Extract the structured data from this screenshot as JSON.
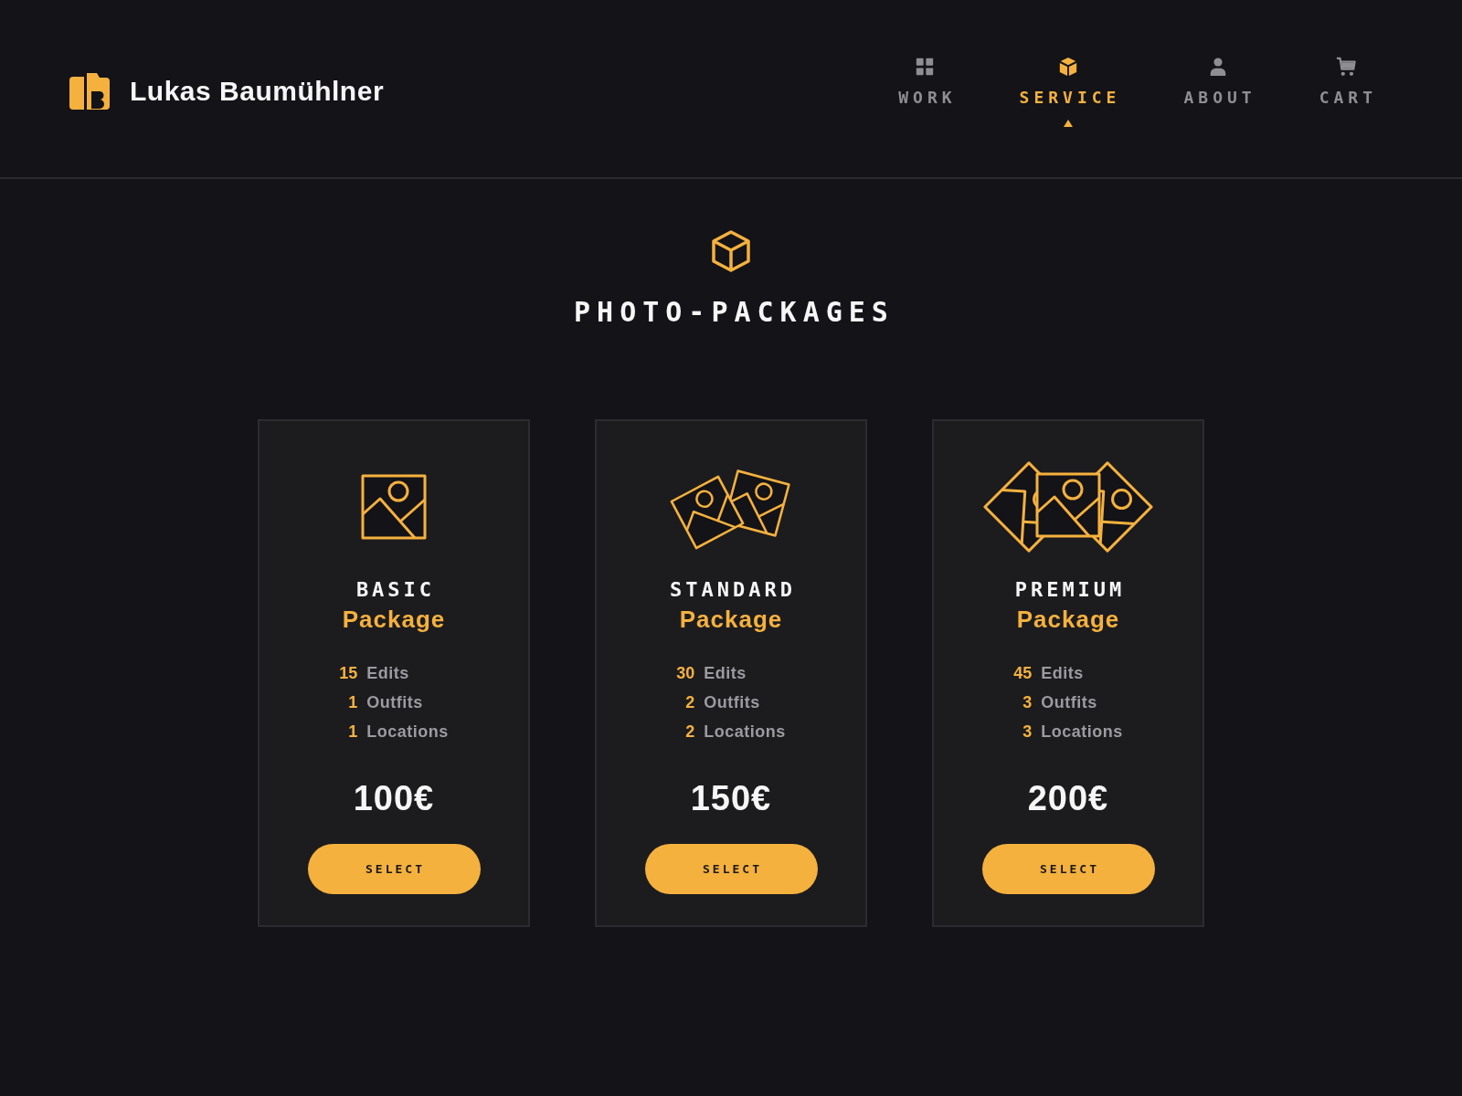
{
  "header": {
    "brand": "Lukas Baumühlner",
    "nav": [
      {
        "label": "WORK",
        "selected": false
      },
      {
        "label": "SERVICE",
        "selected": true
      },
      {
        "label": "ABOUT",
        "selected": false
      },
      {
        "label": "CART",
        "selected": false
      }
    ]
  },
  "section": {
    "title": "PHOTO-PACKAGES"
  },
  "packages": [
    {
      "name": "BASIC",
      "subtitle": "Package",
      "features": [
        {
          "count": "15",
          "label": "Edits"
        },
        {
          "count": "1",
          "label": "Outfits"
        },
        {
          "count": "1",
          "label": "Locations"
        }
      ],
      "price": "100€",
      "button": "SELECT"
    },
    {
      "name": "STANDARD",
      "subtitle": "Package",
      "features": [
        {
          "count": "30",
          "label": "Edits"
        },
        {
          "count": "2",
          "label": "Outfits"
        },
        {
          "count": "2",
          "label": "Locations"
        }
      ],
      "price": "150€",
      "button": "SELECT"
    },
    {
      "name": "PREMIUM",
      "subtitle": "Package",
      "features": [
        {
          "count": "45",
          "label": "Edits"
        },
        {
          "count": "3",
          "label": "Outfits"
        },
        {
          "count": "3",
          "label": "Locations"
        }
      ],
      "price": "200€",
      "button": "SELECT"
    }
  ]
}
